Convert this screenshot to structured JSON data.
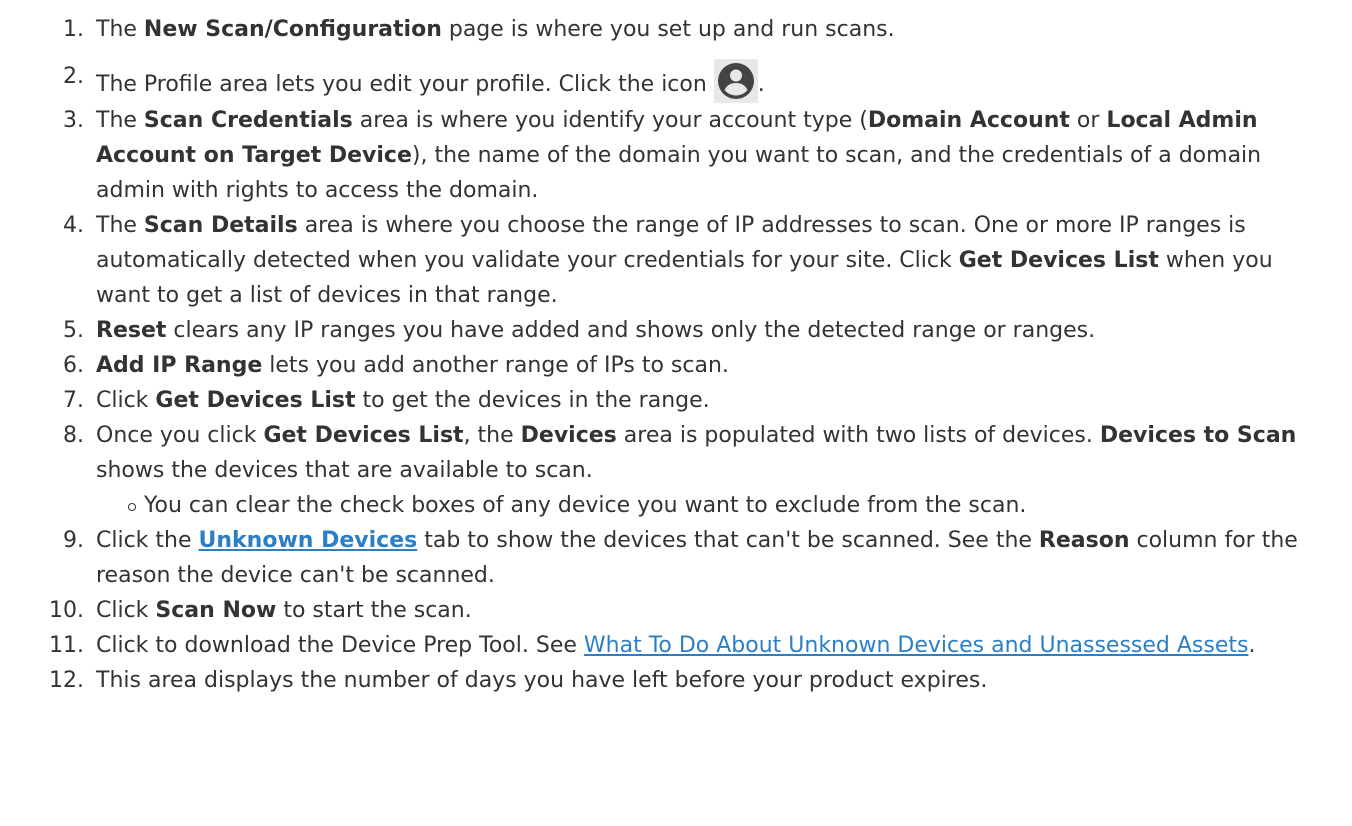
{
  "steps": [
    {
      "num": "1.",
      "parts": [
        "The ",
        "New Scan",
        "/",
        "Configuration",
        " page is where you set up and run scans."
      ]
    },
    {
      "num": "2.",
      "parts": [
        "The Profile area lets you edit your profile. Click the icon ",
        "."
      ]
    },
    {
      "num": "3.",
      "parts": [
        "The ",
        "Scan Credentials",
        " area is where you identify your account type (",
        "Domain Account",
        " or ",
        "Local Admin Account on Target Device",
        "), the name of the domain you want to scan, and the credentials of a domain admin with rights to access the domain."
      ]
    },
    {
      "num": "4.",
      "parts": [
        "The ",
        "Scan Details",
        " area is where you choose the range of IP addresses to scan. One or more IP ranges is automatically detected when you validate your credentials for your site. Click ",
        "Get Devices List",
        " when you want to get a list of devices in that range."
      ]
    },
    {
      "num": "5.",
      "parts": [
        "Reset",
        " clears any IP ranges you have added and shows only the detected range or ranges."
      ]
    },
    {
      "num": "6.",
      "parts": [
        "Add IP Range",
        " lets you add another range of IPs to scan."
      ]
    },
    {
      "num": "7.",
      "parts": [
        "Click ",
        "Get Devices List",
        " to get the devices in the range."
      ]
    },
    {
      "num": "8.",
      "parts": [
        "Once you click ",
        "Get Devices List",
        ", the ",
        "Devices",
        " area is populated with two lists of devices. ",
        "Devices to Scan",
        " shows the devices that are available to scan."
      ],
      "sub": "You can clear the check boxes of any device you want to exclude from the scan."
    },
    {
      "num": "9.",
      "parts": [
        "Click the ",
        "Unknown Devices",
        " tab to show the devices that can't be scanned. See the ",
        "Reason",
        " column for the reason the device can't be scanned."
      ]
    },
    {
      "num": "10.",
      "parts": [
        "Click ",
        "Scan Now",
        " to start the scan."
      ]
    },
    {
      "num": "11.",
      "parts": [
        "Click to download the Device Prep Tool. See ",
        "What To Do About Unknown Devices and Unassessed Assets",
        "."
      ]
    },
    {
      "num": "12.",
      "parts": [
        "This area displays the number of days you have left before your product expires."
      ]
    }
  ],
  "icons": {
    "profile": "account-circle-icon"
  },
  "colors": {
    "text": "#333333",
    "link": "#2a7fc7",
    "icon_bg": "#e8e8e8",
    "icon_fg": "#444444"
  }
}
